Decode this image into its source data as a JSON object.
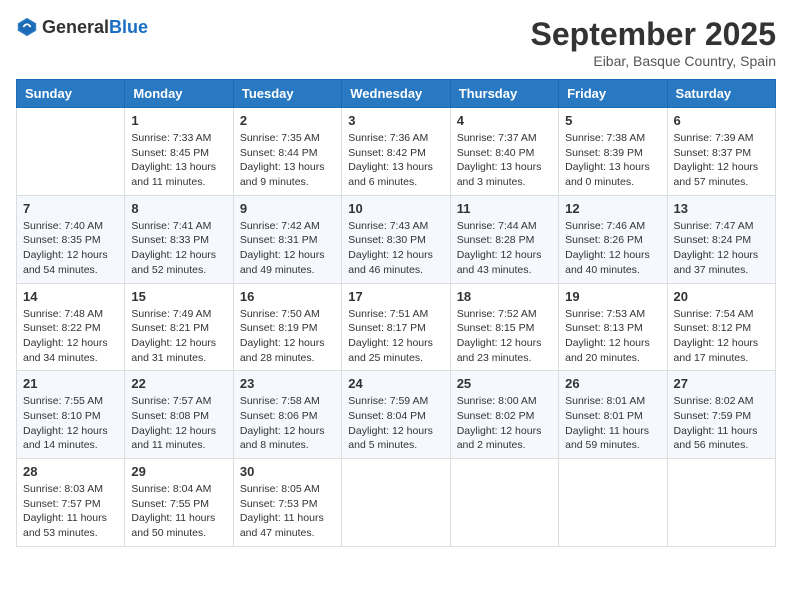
{
  "logo": {
    "general": "General",
    "blue": "Blue"
  },
  "header": {
    "month": "September 2025",
    "location": "Eibar, Basque Country, Spain"
  },
  "weekdays": [
    "Sunday",
    "Monday",
    "Tuesday",
    "Wednesday",
    "Thursday",
    "Friday",
    "Saturday"
  ],
  "weeks": [
    [
      null,
      {
        "day": 1,
        "sunrise": "7:33 AM",
        "sunset": "8:45 PM",
        "daylight": "13 hours and 11 minutes."
      },
      {
        "day": 2,
        "sunrise": "7:35 AM",
        "sunset": "8:44 PM",
        "daylight": "13 hours and 9 minutes."
      },
      {
        "day": 3,
        "sunrise": "7:36 AM",
        "sunset": "8:42 PM",
        "daylight": "13 hours and 6 minutes."
      },
      {
        "day": 4,
        "sunrise": "7:37 AM",
        "sunset": "8:40 PM",
        "daylight": "13 hours and 3 minutes."
      },
      {
        "day": 5,
        "sunrise": "7:38 AM",
        "sunset": "8:39 PM",
        "daylight": "13 hours and 0 minutes."
      },
      {
        "day": 6,
        "sunrise": "7:39 AM",
        "sunset": "8:37 PM",
        "daylight": "12 hours and 57 minutes."
      }
    ],
    [
      {
        "day": 7,
        "sunrise": "7:40 AM",
        "sunset": "8:35 PM",
        "daylight": "12 hours and 54 minutes."
      },
      {
        "day": 8,
        "sunrise": "7:41 AM",
        "sunset": "8:33 PM",
        "daylight": "12 hours and 52 minutes."
      },
      {
        "day": 9,
        "sunrise": "7:42 AM",
        "sunset": "8:31 PM",
        "daylight": "12 hours and 49 minutes."
      },
      {
        "day": 10,
        "sunrise": "7:43 AM",
        "sunset": "8:30 PM",
        "daylight": "12 hours and 46 minutes."
      },
      {
        "day": 11,
        "sunrise": "7:44 AM",
        "sunset": "8:28 PM",
        "daylight": "12 hours and 43 minutes."
      },
      {
        "day": 12,
        "sunrise": "7:46 AM",
        "sunset": "8:26 PM",
        "daylight": "12 hours and 40 minutes."
      },
      {
        "day": 13,
        "sunrise": "7:47 AM",
        "sunset": "8:24 PM",
        "daylight": "12 hours and 37 minutes."
      }
    ],
    [
      {
        "day": 14,
        "sunrise": "7:48 AM",
        "sunset": "8:22 PM",
        "daylight": "12 hours and 34 minutes."
      },
      {
        "day": 15,
        "sunrise": "7:49 AM",
        "sunset": "8:21 PM",
        "daylight": "12 hours and 31 minutes."
      },
      {
        "day": 16,
        "sunrise": "7:50 AM",
        "sunset": "8:19 PM",
        "daylight": "12 hours and 28 minutes."
      },
      {
        "day": 17,
        "sunrise": "7:51 AM",
        "sunset": "8:17 PM",
        "daylight": "12 hours and 25 minutes."
      },
      {
        "day": 18,
        "sunrise": "7:52 AM",
        "sunset": "8:15 PM",
        "daylight": "12 hours and 23 minutes."
      },
      {
        "day": 19,
        "sunrise": "7:53 AM",
        "sunset": "8:13 PM",
        "daylight": "12 hours and 20 minutes."
      },
      {
        "day": 20,
        "sunrise": "7:54 AM",
        "sunset": "8:12 PM",
        "daylight": "12 hours and 17 minutes."
      }
    ],
    [
      {
        "day": 21,
        "sunrise": "7:55 AM",
        "sunset": "8:10 PM",
        "daylight": "12 hours and 14 minutes."
      },
      {
        "day": 22,
        "sunrise": "7:57 AM",
        "sunset": "8:08 PM",
        "daylight": "12 hours and 11 minutes."
      },
      {
        "day": 23,
        "sunrise": "7:58 AM",
        "sunset": "8:06 PM",
        "daylight": "12 hours and 8 minutes."
      },
      {
        "day": 24,
        "sunrise": "7:59 AM",
        "sunset": "8:04 PM",
        "daylight": "12 hours and 5 minutes."
      },
      {
        "day": 25,
        "sunrise": "8:00 AM",
        "sunset": "8:02 PM",
        "daylight": "12 hours and 2 minutes."
      },
      {
        "day": 26,
        "sunrise": "8:01 AM",
        "sunset": "8:01 PM",
        "daylight": "11 hours and 59 minutes."
      },
      {
        "day": 27,
        "sunrise": "8:02 AM",
        "sunset": "7:59 PM",
        "daylight": "11 hours and 56 minutes."
      }
    ],
    [
      {
        "day": 28,
        "sunrise": "8:03 AM",
        "sunset": "7:57 PM",
        "daylight": "11 hours and 53 minutes."
      },
      {
        "day": 29,
        "sunrise": "8:04 AM",
        "sunset": "7:55 PM",
        "daylight": "11 hours and 50 minutes."
      },
      {
        "day": 30,
        "sunrise": "8:05 AM",
        "sunset": "7:53 PM",
        "daylight": "11 hours and 47 minutes."
      },
      null,
      null,
      null,
      null
    ]
  ]
}
